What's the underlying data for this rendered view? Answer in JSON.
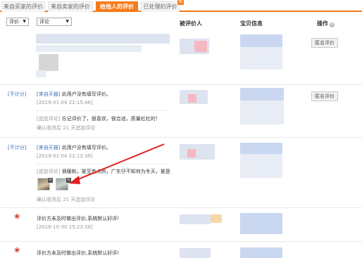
{
  "tabs": [
    {
      "label": "来自买家的评价"
    },
    {
      "label": "来自卖家的评价"
    },
    {
      "label": "给他人的评价"
    },
    {
      "label": "已处理的评价"
    }
  ],
  "tab_badge": "新",
  "filters": {
    "rating": "评价",
    "comment": "评论"
  },
  "columns": {
    "rated_user": "被评价人",
    "item_info": "宝贝信息",
    "action": "操作",
    "action_info_icon": "i"
  },
  "rows": [
    {
      "button": "匿名评价"
    },
    {
      "score": "[不计分]",
      "source": "[来自天猫]",
      "comment": "此用户没有填写评价。",
      "date": "[2019-01-04 22:15:46]",
      "append_tag": "[追加评论]",
      "append_text": "忘记评价了，很喜欢，很合适，质量杠杠的！",
      "append_note": "确认收货后 21 天追加评论",
      "button": "匿名评价"
    },
    {
      "score": "[不计分]",
      "source": "[来自天猫]",
      "comment": "此用户没有填写评价。",
      "date": "[2019-01-04 22:12:36]",
      "append_tag": "[追加评论]",
      "append_text": "很暖和，甚至有点热，广东仔不知何为冬天，甚是",
      "append_note": "确认收货后 21 天追加评论",
      "thumb_close": "×"
    },
    {
      "comment": "评价方未及时做出评价,系统默认好评!",
      "date": "[2018-10-30 15:23:58]",
      "flower": "❀"
    },
    {
      "comment": "评价方未及时做出评价,系统默认好评!",
      "flower": "❀"
    }
  ],
  "colors": {
    "accent": "#f57a19",
    "link": "#3a6fb5",
    "annotation_arrow": "#e02020"
  }
}
